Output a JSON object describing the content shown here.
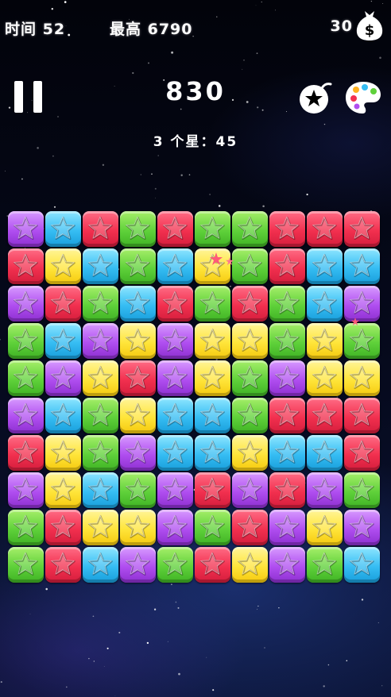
{
  "hud": {
    "time_label": "时间 52",
    "best_label": "最高 6790",
    "coins": "30",
    "score": "830",
    "bonus_text": "3 个星：45"
  },
  "icons": {
    "pause": "pause-icon",
    "coin_bag": "money-bag-icon",
    "bomb": "bomb-star-icon",
    "palette": "paint-palette-icon"
  },
  "colors": {
    "red": "#f2304f",
    "green": "#5fd13a",
    "blue": "#36bdf3",
    "yellow": "#ffe53a",
    "purple": "#b04ef0"
  },
  "board": {
    "columns": 10,
    "rows": 10,
    "tiles": [
      [
        "purple",
        "blue",
        "red",
        "green",
        "red",
        "green",
        "green",
        "red",
        "red",
        "red"
      ],
      [
        "red",
        "yellow",
        "blue",
        "green",
        "blue",
        "yellow",
        "green",
        "red",
        "blue",
        "blue"
      ],
      [
        "purple",
        "red",
        "green",
        "blue",
        "red",
        "green",
        "red",
        "green",
        "blue",
        "purple"
      ],
      [
        "green",
        "blue",
        "purple",
        "yellow",
        "purple",
        "yellow",
        "yellow",
        "green",
        "yellow",
        "green"
      ],
      [
        "green",
        "purple",
        "yellow",
        "red",
        "purple",
        "yellow",
        "green",
        "purple",
        "yellow",
        "yellow"
      ],
      [
        "purple",
        "blue",
        "green",
        "yellow",
        "blue",
        "blue",
        "green",
        "red",
        "red",
        "red"
      ],
      [
        "red",
        "yellow",
        "green",
        "purple",
        "blue",
        "blue",
        "yellow",
        "blue",
        "blue",
        "red"
      ],
      [
        "purple",
        "yellow",
        "blue",
        "green",
        "purple",
        "red",
        "purple",
        "red",
        "purple",
        "green"
      ],
      [
        "green",
        "red",
        "yellow",
        "yellow",
        "purple",
        "green",
        "red",
        "purple",
        "yellow",
        "purple"
      ],
      [
        "green",
        "red",
        "blue",
        "purple",
        "green",
        "red",
        "yellow",
        "purple",
        "green",
        "blue"
      ]
    ]
  }
}
